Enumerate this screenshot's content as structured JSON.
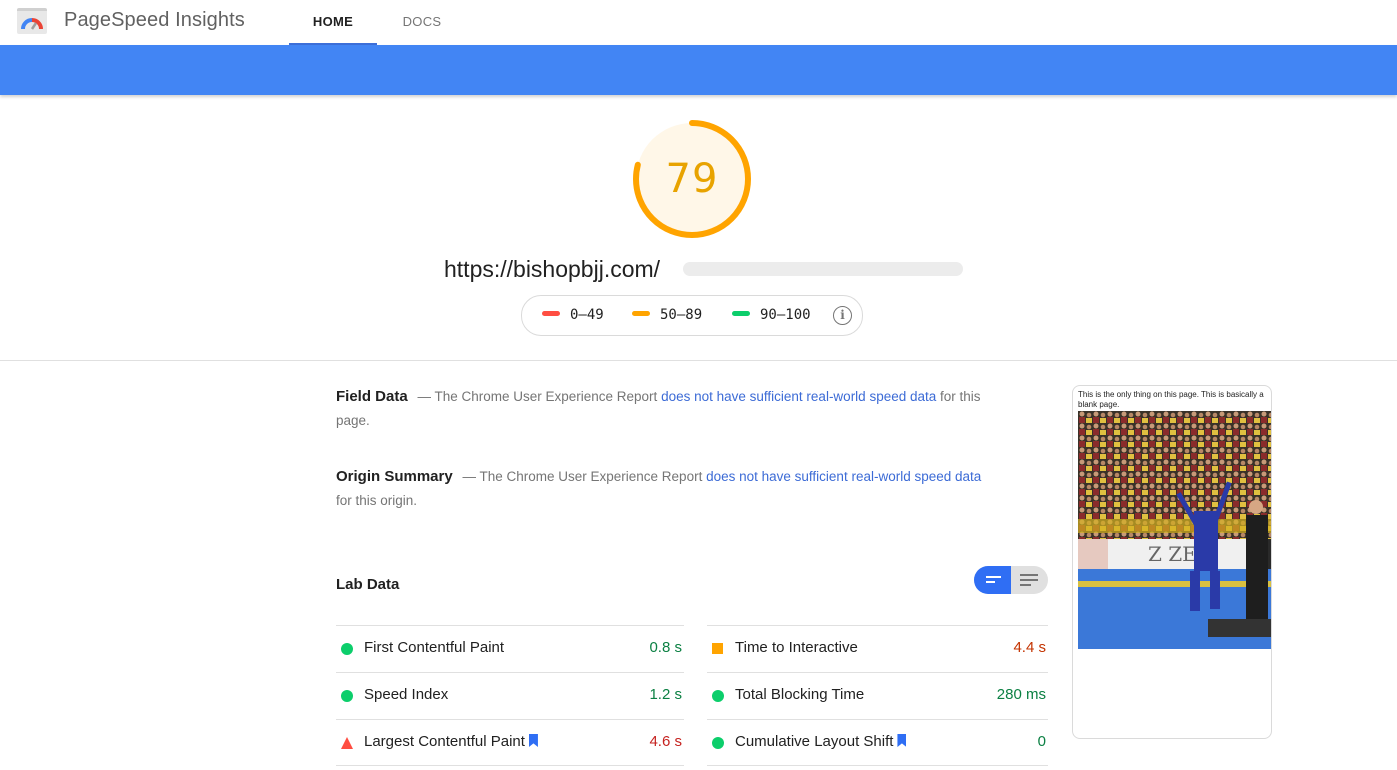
{
  "header": {
    "brand": "PageSpeed Insights",
    "tabs": [
      {
        "label": "HOME",
        "active": true
      },
      {
        "label": "DOCS",
        "active": false
      }
    ]
  },
  "colors": {
    "brand_blue": "#4285f4",
    "average": "#ffa400",
    "pass": "#0cce6b",
    "fail": "#ff4e42",
    "link": "#3c6bd6"
  },
  "score": {
    "value": "79",
    "fraction": 0.79,
    "rating": "average"
  },
  "url": {
    "visible": "https://bishopbjj.com/"
  },
  "legend": [
    {
      "label": "0–49",
      "rating": "fail",
      "color": "#ff4e42"
    },
    {
      "label": "50–89",
      "rating": "average",
      "color": "#ffa400"
    },
    {
      "label": "90–100",
      "rating": "pass",
      "color": "#0cce6b"
    }
  ],
  "field_data": {
    "title": "Field Data",
    "prefix": "— The Chrome User Experience Report",
    "link": "does not have sufficient real-world speed data",
    "suffix": "for this page."
  },
  "origin_summary": {
    "title": "Origin Summary",
    "prefix": "— The Chrome User Experience Report",
    "link": "does not have sufficient real-world speed data",
    "suffix": "for this origin."
  },
  "lab_data": {
    "title": "Lab Data",
    "view_toggle": {
      "selected": "compact"
    },
    "metrics": [
      {
        "label": "First Contentful Paint",
        "value": "0.8 s",
        "rating": "pass",
        "bookmark": false
      },
      {
        "label": "Time to Interactive",
        "value": "4.4 s",
        "rating": "average",
        "bookmark": false
      },
      {
        "label": "Speed Index",
        "value": "1.2 s",
        "rating": "pass",
        "bookmark": false
      },
      {
        "label": "Total Blocking Time",
        "value": "280 ms",
        "rating": "pass",
        "bookmark": false
      },
      {
        "label": "Largest Contentful Paint",
        "value": "4.6 s",
        "rating": "fail",
        "bookmark": true
      },
      {
        "label": "Cumulative Layout Shift",
        "value": "0",
        "rating": "pass",
        "bookmark": true
      }
    ]
  },
  "final_screenshot": {
    "caption": "This is the only thing on this page. This is basically a blank page.",
    "image_description": "bjj-competitor-celebrating-photo"
  }
}
